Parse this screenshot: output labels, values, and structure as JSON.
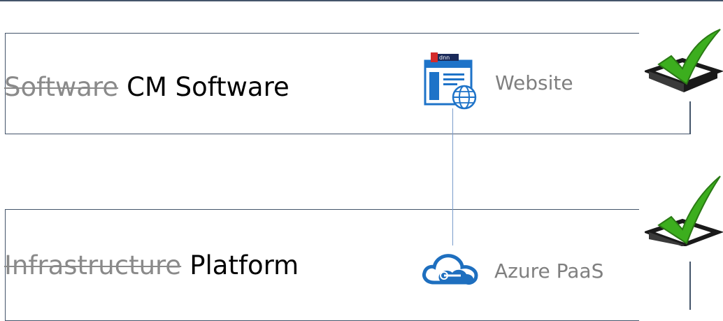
{
  "layers": [
    {
      "id": "software",
      "struck_label": "Software",
      "label": "CM Software",
      "service": {
        "label": "Website",
        "icon": "website-globe-icon"
      },
      "status_icon": "checkmark-icon"
    },
    {
      "id": "platform",
      "struck_label": "Infrastructure",
      "label": "Platform",
      "service": {
        "label": "Azure PaaS",
        "icon": "cloud-icon"
      },
      "status_icon": "checkmark-icon"
    }
  ],
  "colors": {
    "outline": "#44546a",
    "struck_text": "#8a8a8a",
    "service_text": "#7f7f7f",
    "connector": "#7a9ccb",
    "check_green": "#3cae1e",
    "cloud_blue": "#1e6fbf"
  }
}
